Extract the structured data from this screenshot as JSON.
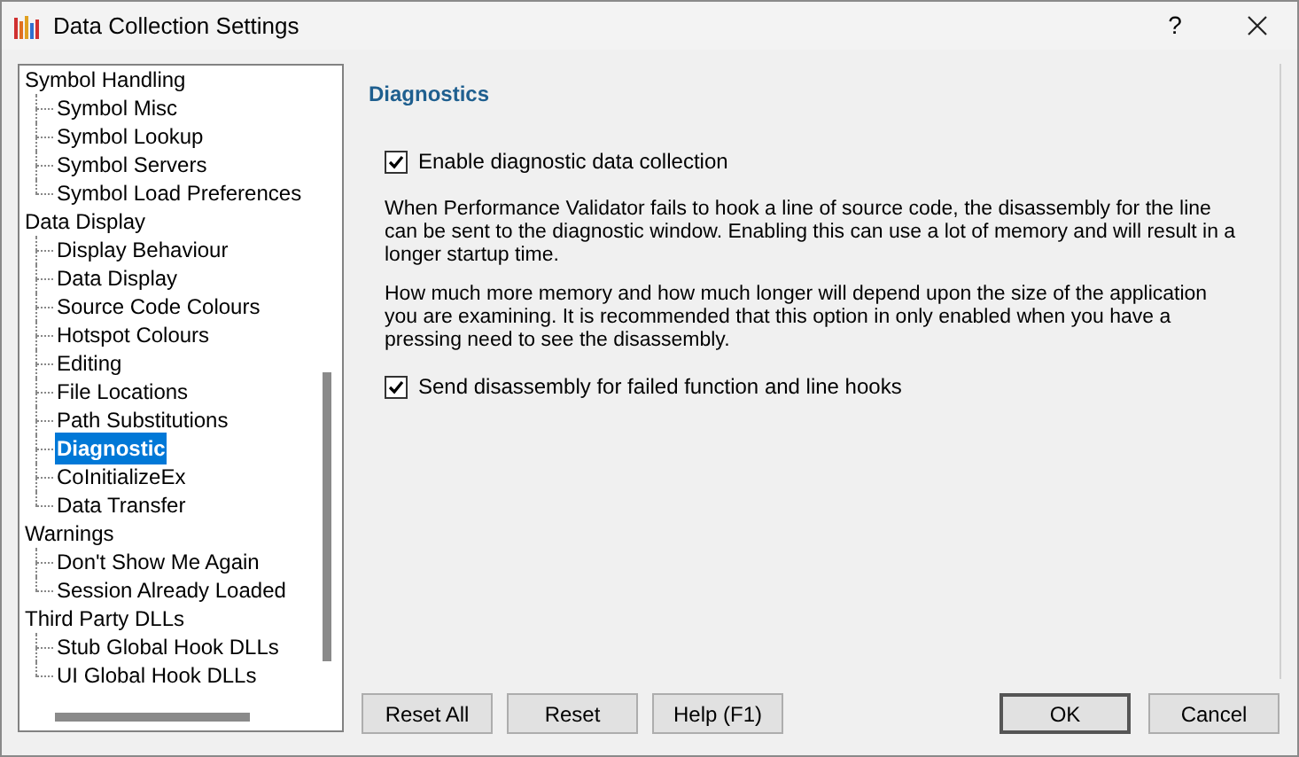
{
  "window": {
    "title": "Data Collection Settings",
    "help": "?"
  },
  "tree": [
    {
      "label": "Symbol Handling",
      "selected": false,
      "children": [
        {
          "label": "Symbol Misc",
          "selected": false
        },
        {
          "label": "Symbol Lookup",
          "selected": false
        },
        {
          "label": "Symbol Servers",
          "selected": false
        },
        {
          "label": "Symbol Load Preferences",
          "selected": false
        }
      ]
    },
    {
      "label": "Data Display",
      "selected": false,
      "children": [
        {
          "label": "Display Behaviour",
          "selected": false
        },
        {
          "label": "Data Display",
          "selected": false
        },
        {
          "label": "Source Code Colours",
          "selected": false
        },
        {
          "label": "Hotspot Colours",
          "selected": false
        },
        {
          "label": "Editing",
          "selected": false
        },
        {
          "label": "File Locations",
          "selected": false
        },
        {
          "label": "Path Substitutions",
          "selected": false
        },
        {
          "label": "Diagnostic",
          "selected": true
        },
        {
          "label": "CoInitializeEx",
          "selected": false
        },
        {
          "label": "Data Transfer",
          "selected": false
        }
      ]
    },
    {
      "label": "Warnings",
      "selected": false,
      "children": [
        {
          "label": "Don't Show Me Again",
          "selected": false
        },
        {
          "label": "Session Already Loaded",
          "selected": false
        }
      ]
    },
    {
      "label": "Third Party DLLs",
      "selected": false,
      "children": [
        {
          "label": "Stub Global Hook DLLs",
          "selected": false
        },
        {
          "label": "UI Global Hook DLLs",
          "selected": false
        }
      ]
    }
  ],
  "panel": {
    "heading": "Diagnostics",
    "items": [
      {
        "kind": "checkbox",
        "label": "Enable diagnostic data collection",
        "checked": true
      },
      {
        "kind": "text",
        "text": "When Performance Validator fails to hook a line of source code, the disassembly for the line can be sent to the diagnostic window. Enabling this can use a lot of memory and will result in a longer startup time."
      },
      {
        "kind": "text",
        "text": "How much more memory and how much longer will depend upon the size of the application you are examining. It is recommended that this option in only enabled when you have a pressing need to see the disassembly."
      },
      {
        "kind": "checkbox",
        "label": "Send disassembly for failed function and line hooks",
        "checked": true
      }
    ]
  },
  "buttons_left": [
    "Reset All",
    "Reset",
    "Help (F1)"
  ],
  "buttons_right": [
    {
      "label": "OK",
      "default": true
    },
    {
      "label": "Cancel",
      "default": false
    }
  ]
}
